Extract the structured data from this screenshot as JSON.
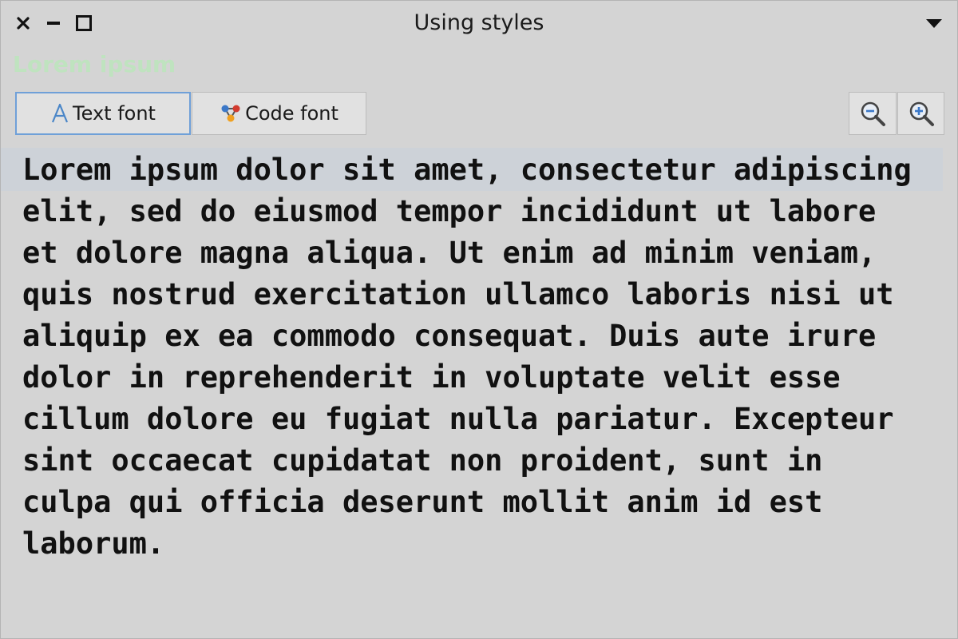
{
  "window": {
    "title": "Using styles"
  },
  "subtitle": {
    "text": "Lorem ipsum",
    "color": "#bfe3bf"
  },
  "toolbar": {
    "text_font_label": "Text font",
    "code_font_label": "Code font",
    "zoom_out_icon": "zoom-out-icon",
    "zoom_in_icon": "zoom-in-icon"
  },
  "content": {
    "lines": [
      "Lorem ipsum dolor sit amet, consectetur adipiscing",
      "elit, sed do eiusmod tempor incididunt ut labore",
      "et dolore magna aliqua. Ut enim ad minim veniam,",
      "quis nostrud exercitation ullamco laboris nisi ut",
      "aliquip ex ea commodo consequat. Duis aute irure",
      "dolor in reprehenderit in voluptate velit esse",
      "cillum dolore eu fugiat nulla pariatur. Excepteur",
      "sint occaecat cupidatat non proident, sunt in",
      "culpa qui officia deserunt mollit anim id est",
      "laborum."
    ]
  },
  "colors": {
    "window_background": "#d4d4d4",
    "selected_button_border": "#6fa0d8",
    "first_line_highlight": "#cdd2d8"
  }
}
